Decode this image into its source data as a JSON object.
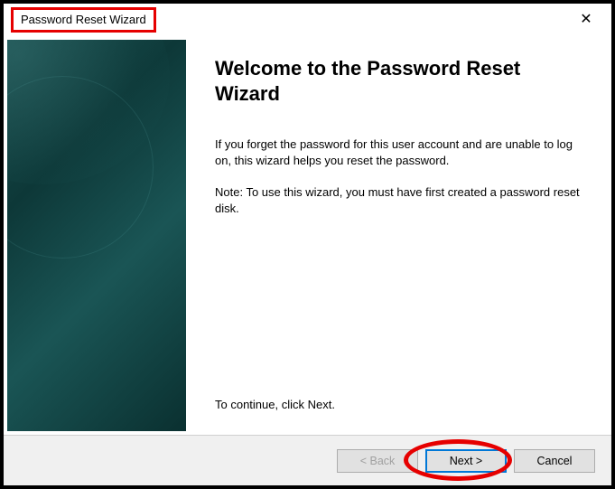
{
  "window": {
    "title": "Password Reset Wizard"
  },
  "main": {
    "heading": "Welcome to the Password Reset Wizard",
    "description": "If you forget the password for this user account and are unable to log on, this wizard helps you reset the password.",
    "note": "Note: To use this wizard, you must have first created a password reset disk.",
    "continue_text": "To continue, click Next."
  },
  "buttons": {
    "back": "< Back",
    "next": "Next >",
    "cancel": "Cancel"
  }
}
